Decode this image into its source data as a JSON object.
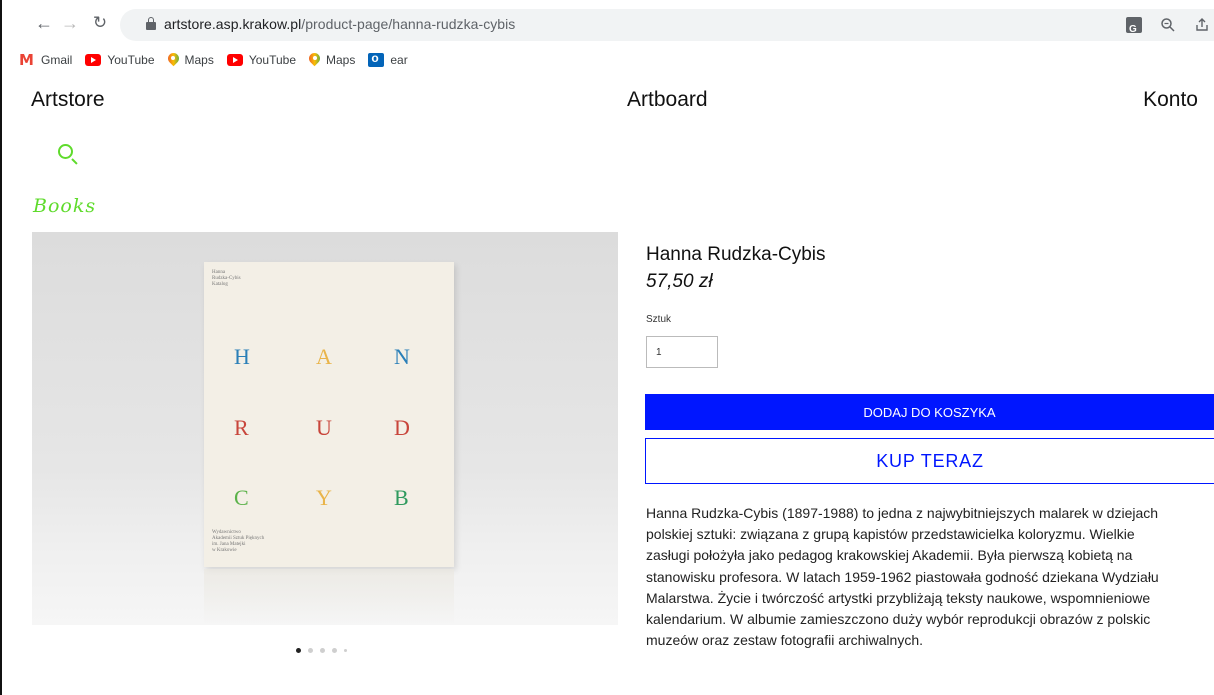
{
  "browser": {
    "url_domain": "artstore.asp.krakow.pl",
    "url_path": "/product-page/hanna-rudzka-cybis",
    "bookmarks": [
      {
        "label": "Gmail",
        "icon": "gmail-icon"
      },
      {
        "label": "YouTube",
        "icon": "youtube-icon"
      },
      {
        "label": "Maps",
        "icon": "maps-icon"
      },
      {
        "label": "YouTube",
        "icon": "youtube-icon"
      },
      {
        "label": "Maps",
        "icon": "maps-icon"
      },
      {
        "label": "ear",
        "icon": "outlook-icon"
      }
    ]
  },
  "site": {
    "nav": {
      "artstore": "Artstore",
      "artboard": "Artboard",
      "konto": "Konto"
    },
    "category": "Books",
    "accent_color": "#5fdb2c",
    "button_color": "#0016ff"
  },
  "product": {
    "title": "Hanna Rudzka-Cybis",
    "price": "57,50 zł",
    "quantity_label": "Sztuk",
    "quantity_value": "1",
    "add_to_cart_label": "DODAJ DO KOSZYKA",
    "buy_now_label": "KUP TERAZ",
    "description_lines": [
      "Hanna Rudzka-Cybis (1897-1988) to jedna z najwybitniejszych malarek w dziejach",
      "polskiej sztuki: związana z grupą kapistów przedstawicielka koloryzmu. Wielkie",
      "zasługi położyła jako pedagog krakowskiej Akademii. Była pierwszą kobietą na",
      "stanowisku profesora. W latach 1959-1962 piastowała godność dziekana Wydziału",
      "Malarstwa. Życie i twórczość artystki przybliżają teksty naukowe, wspomnieniowe",
      "kalendarium. W albumie zamieszczono duży wybór reprodukcji obrazów z polskic",
      "muzeów oraz zestaw fotografii archiwalnych."
    ],
    "image": {
      "book_letters": [
        {
          "char": "H",
          "color": "#2a7fb8"
        },
        {
          "char": "A",
          "color": "#e9b44a"
        },
        {
          "char": "N",
          "color": "#2a7fb8"
        },
        {
          "char": "R",
          "color": "#c8453b"
        },
        {
          "char": "U",
          "color": "#c8453b"
        },
        {
          "char": "D",
          "color": "#c8453b"
        },
        {
          "char": "C",
          "color": "#5bb24a"
        },
        {
          "char": "Y",
          "color": "#e9b44a"
        },
        {
          "char": "B",
          "color": "#2f9a5e"
        }
      ],
      "cover_top_text": [
        "Hanna",
        "Rudzka-Cybis",
        "Katalog"
      ],
      "cover_bottom_text": [
        "Wydawnictwo",
        "Akademii Sztuk Pięknych",
        "im. Jana Matejki",
        "w Krakowie"
      ]
    },
    "carousel_dots": 5,
    "carousel_active": 1
  }
}
